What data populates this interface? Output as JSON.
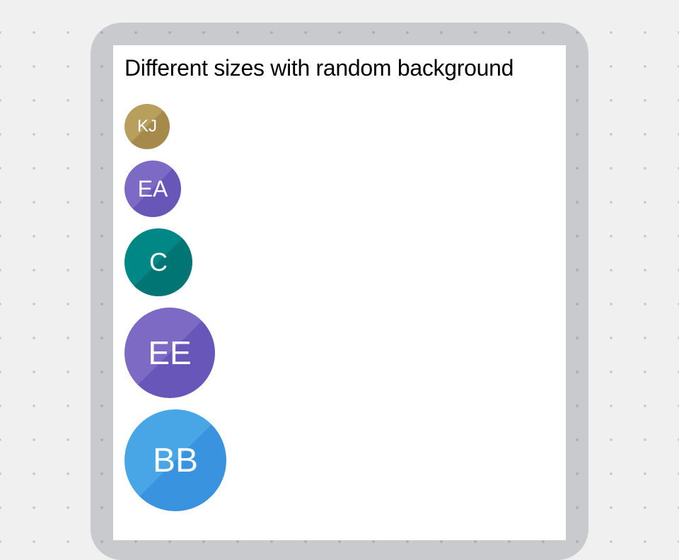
{
  "title": "Different sizes with random background",
  "avatars": [
    {
      "initials": "KJ",
      "light": "#b89f5e",
      "dark": "#a58a4c"
    },
    {
      "initials": "EA",
      "light": "#7c6ac4",
      "dark": "#6856b9"
    },
    {
      "initials": "C",
      "light": "#018786",
      "dark": "#017573"
    },
    {
      "initials": "EE",
      "light": "#7c6ac4",
      "dark": "#6856b9"
    },
    {
      "initials": "BB",
      "light": "#49a6e6",
      "dark": "#3a93de"
    }
  ]
}
